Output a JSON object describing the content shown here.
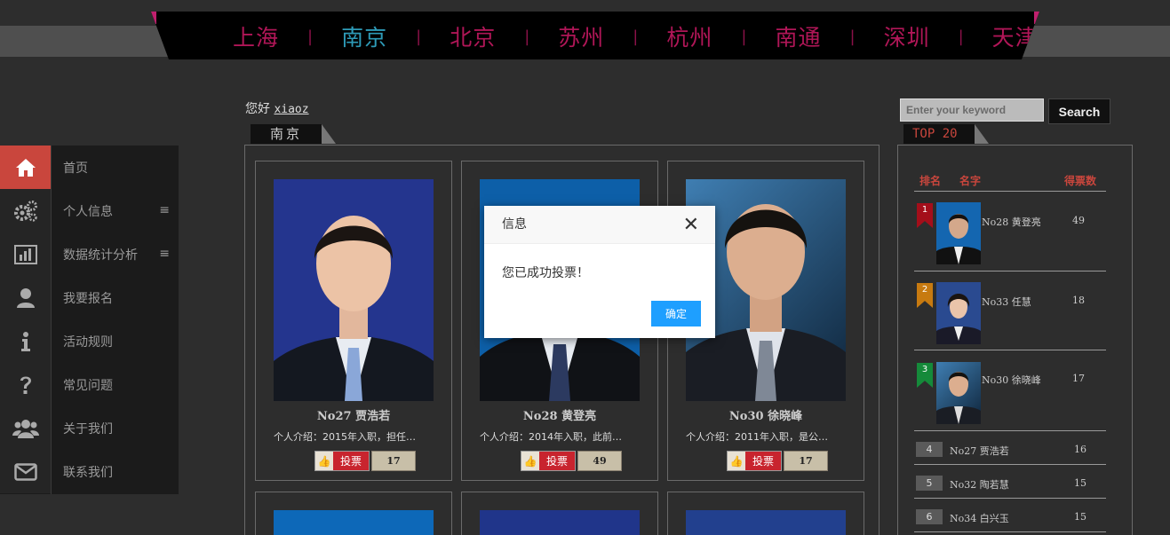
{
  "nav": {
    "cities": [
      "上海",
      "南京",
      "北京",
      "苏州",
      "杭州",
      "南通",
      "深圳",
      "天津"
    ],
    "active_city": "南京",
    "separator": "|"
  },
  "sidebar": {
    "items": [
      {
        "label": "首页",
        "icon": "home-icon",
        "active": true
      },
      {
        "label": "个人信息",
        "icon": "gears-icon",
        "menu": "≡"
      },
      {
        "label": "数据统计分析",
        "icon": "bar-chart-icon",
        "menu": "≡"
      },
      {
        "label": "我要报名",
        "icon": "user-icon"
      },
      {
        "label": "活动规则",
        "icon": "info-icon"
      },
      {
        "label": "常见问题",
        "icon": "question-icon"
      },
      {
        "label": "关于我们",
        "icon": "users-icon"
      },
      {
        "label": "联系我们",
        "icon": "envelope-icon"
      }
    ]
  },
  "greeting": {
    "prefix": "您好",
    "username": "xiaoz"
  },
  "section": {
    "title": "南京"
  },
  "candidates": [
    {
      "name": "No27 贾浩若",
      "intro": "个人介绍：2015年入职，担任…",
      "vote_label": "投票",
      "votes": "17"
    },
    {
      "name": "No28 黄登亮",
      "intro": "个人介绍：2014年入职，此前…",
      "vote_label": "投票",
      "votes": "49"
    },
    {
      "name": "No30 徐晓峰",
      "intro": "个人介绍：2011年入职，是公…",
      "vote_label": "投票",
      "votes": "17"
    }
  ],
  "search": {
    "placeholder": "Enter your keyword",
    "button": "Search"
  },
  "top": {
    "title": "TOP 20",
    "headers": {
      "rank": "排名",
      "name": "名字",
      "score": "得票数"
    },
    "featured": [
      {
        "rank": "1",
        "name": "No28 黄登亮",
        "score": "49",
        "color": "#a40e1a"
      },
      {
        "rank": "2",
        "name": "No33 任慧",
        "score": "18",
        "color": "#c77a10"
      },
      {
        "rank": "3",
        "name": "No30 徐晓峰",
        "score": "17",
        "color": "#158a3a"
      }
    ],
    "others": [
      {
        "rank": "4",
        "name": "No27 贾浩若",
        "score": "16"
      },
      {
        "rank": "5",
        "name": "No32 陶若慧",
        "score": "15"
      },
      {
        "rank": "6",
        "name": "No34 白兴玉",
        "score": "15"
      }
    ]
  },
  "dialog": {
    "title": "信息",
    "message": "您已成功投票！",
    "ok": "确定",
    "close": "✕"
  },
  "colors": {
    "accent": "#c9463d",
    "nav_text": "#b01657",
    "nav_active": "#2e9bb8",
    "dialog_button": "#1e9fff"
  }
}
